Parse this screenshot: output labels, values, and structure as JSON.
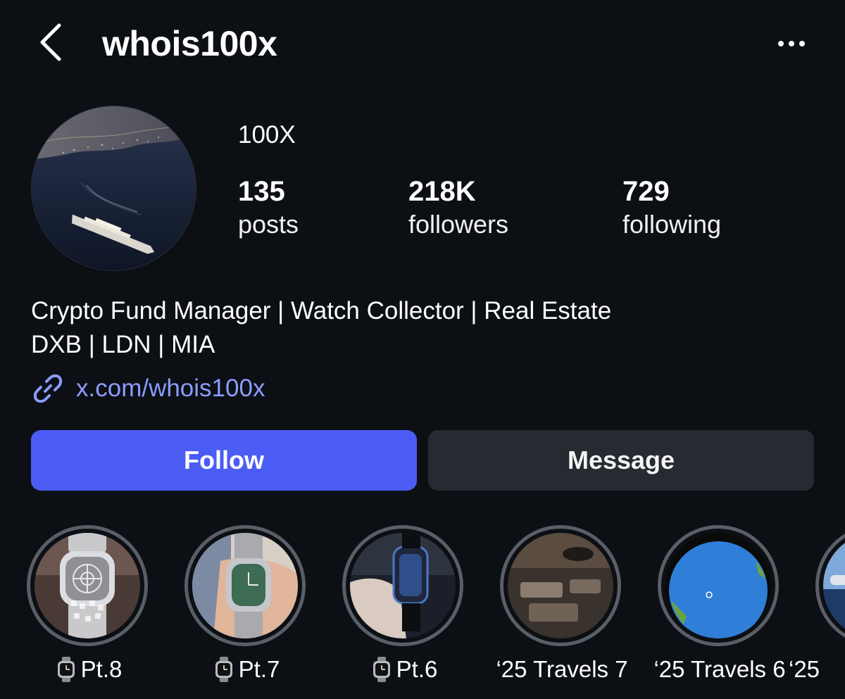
{
  "header": {
    "username": "whois100x",
    "back_icon": "chevron-left-icon",
    "more_icon": "more-horizontal-icon"
  },
  "profile": {
    "display_name": "100X",
    "stats": [
      {
        "value": "135",
        "label": "posts"
      },
      {
        "value": "218K",
        "label": "followers"
      },
      {
        "value": "729",
        "label": "following"
      }
    ],
    "bio_lines": [
      "Crypto Fund Manager | Watch Collector | Real Estate",
      "DXB | LDN | MIA"
    ],
    "link": "x.com/whois100x",
    "link_icon": "link-icon"
  },
  "actions": {
    "follow_label": "Follow",
    "message_label": "Message"
  },
  "highlights": [
    {
      "label": "Pt.8",
      "emoji": "watch-icon"
    },
    {
      "label": "Pt.7",
      "emoji": "watch-icon"
    },
    {
      "label": "Pt.6",
      "emoji": "watch-icon"
    },
    {
      "label": "‘25 Travels 7"
    },
    {
      "label": "‘25 Travels 6"
    },
    {
      "label": "‘25"
    }
  ],
  "colors": {
    "background": "#0c0f14",
    "follow_button": "#4b5cf5",
    "message_button": "#262a31",
    "link": "#8b9dff",
    "highlight_ring": "#5a5e66"
  }
}
